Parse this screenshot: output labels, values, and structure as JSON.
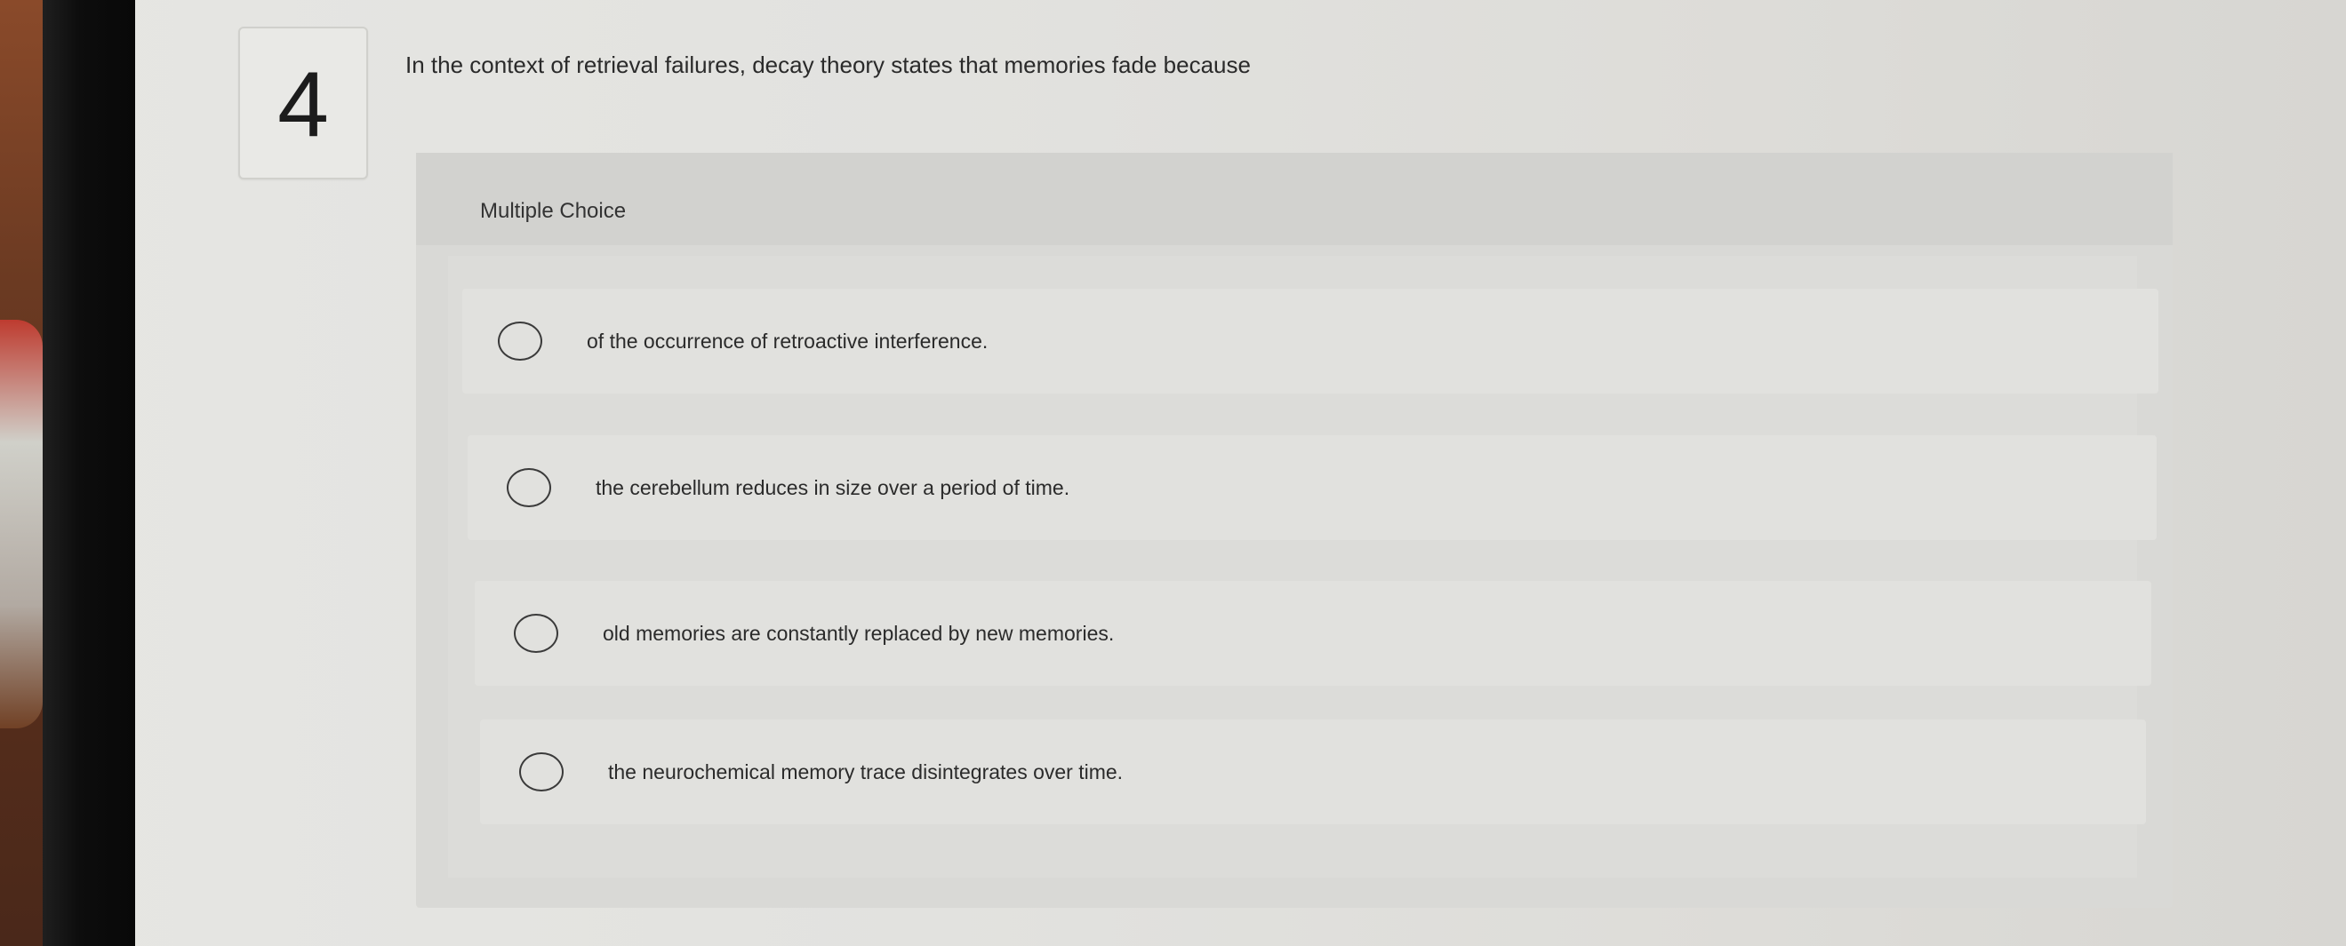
{
  "question": {
    "number": "4",
    "prompt": "In the context of retrieval failures, decay theory states that memories fade because"
  },
  "answer_panel": {
    "type_label": "Multiple Choice",
    "options": [
      {
        "text": "of the occurrence of retroactive interference.",
        "selected": false
      },
      {
        "text": "the cerebellum reduces in size over a period of time.",
        "selected": false
      },
      {
        "text": "old memories are constantly replaced by new memories.",
        "selected": false
      },
      {
        "text": "the neurochemical memory trace disintegrates over time.",
        "selected": false
      }
    ]
  }
}
